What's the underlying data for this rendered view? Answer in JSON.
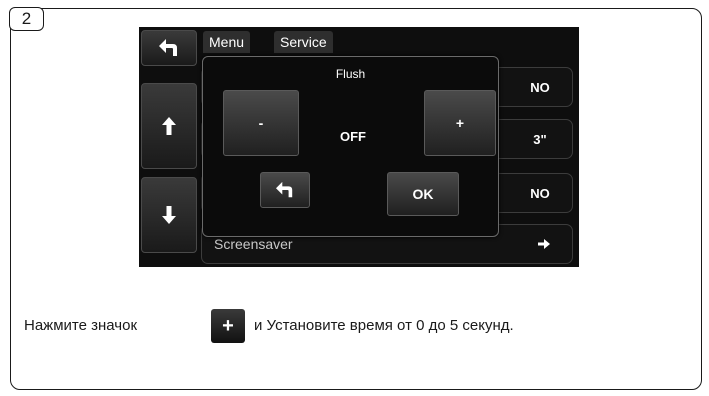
{
  "step_number": "2",
  "screen": {
    "tabs": [
      "Menu",
      "Service"
    ],
    "rows": [
      {
        "value": "NO"
      },
      {
        "value": "3\""
      },
      {
        "value": "NO"
      },
      {
        "label": "Screensaver"
      }
    ],
    "dialog": {
      "title": "Flush",
      "minus_label": "-",
      "plus_label": "+",
      "value": "OFF",
      "ok_label": "OK"
    }
  },
  "instruction": {
    "before": "Нажмите значок",
    "icon_label": "+",
    "after": "и Установите время от 0 до 5 секунд."
  },
  "icons": [
    "back-arrow-icon",
    "up-arrow-icon",
    "down-arrow-icon",
    "right-arrow-icon"
  ]
}
